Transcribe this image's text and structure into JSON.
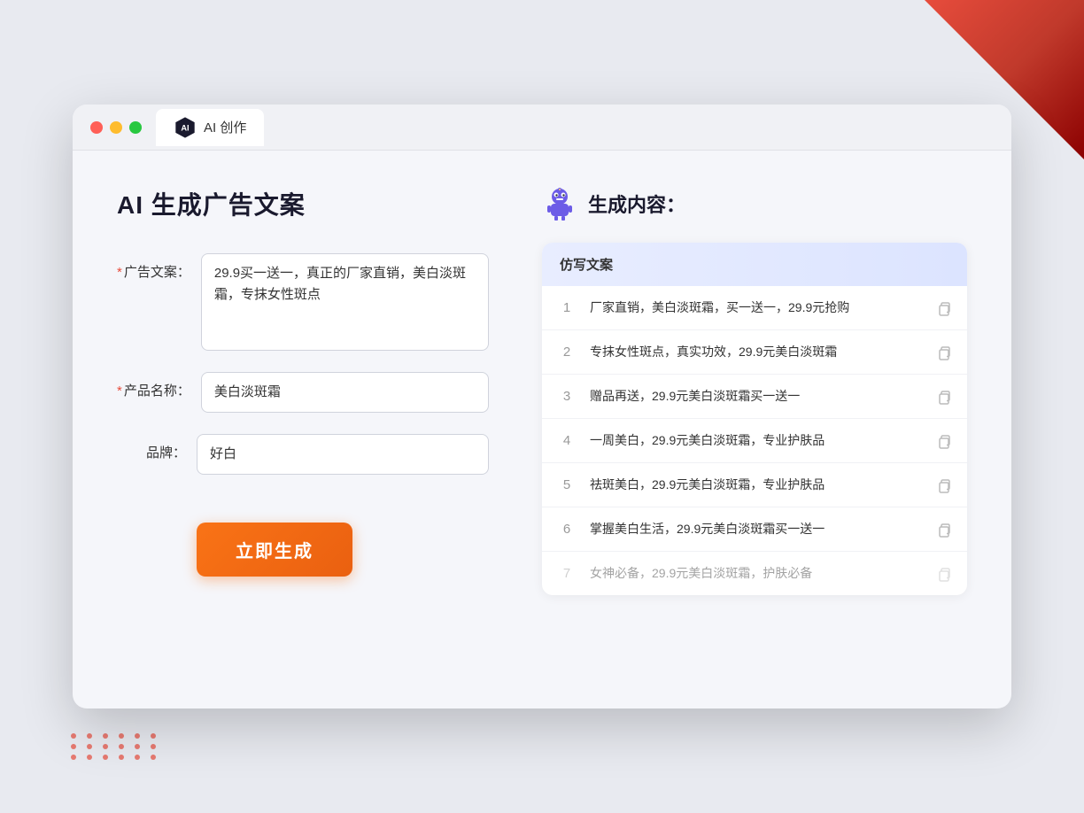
{
  "window": {
    "tab_label": "AI 创作",
    "traffic_lights": [
      "red",
      "yellow",
      "green"
    ]
  },
  "left_panel": {
    "title": "AI 生成广告文案",
    "form": {
      "ad_copy_label": "广告文案：",
      "ad_copy_required": "*",
      "ad_copy_value": "29.9买一送一，真正的厂家直销，美白淡斑霜，专抹女性斑点",
      "product_name_label": "产品名称：",
      "product_name_required": "*",
      "product_name_value": "美白淡斑霜",
      "brand_label": "品牌：",
      "brand_value": "好白"
    },
    "generate_button": "立即生成"
  },
  "right_panel": {
    "title": "生成内容：",
    "table_header": "仿写文案",
    "results": [
      {
        "num": "1",
        "text": "厂家直销，美白淡斑霜，买一送一，29.9元抢购",
        "faded": false
      },
      {
        "num": "2",
        "text": "专抹女性斑点，真实功效，29.9元美白淡斑霜",
        "faded": false
      },
      {
        "num": "3",
        "text": "赠品再送，29.9元美白淡斑霜买一送一",
        "faded": false
      },
      {
        "num": "4",
        "text": "一周美白，29.9元美白淡斑霜，专业护肤品",
        "faded": false
      },
      {
        "num": "5",
        "text": "祛斑美白，29.9元美白淡斑霜，专业护肤品",
        "faded": false
      },
      {
        "num": "6",
        "text": "掌握美白生活，29.9元美白淡斑霜买一送一",
        "faded": false
      },
      {
        "num": "7",
        "text": "女神必备，29.9元美白淡斑霜，护肤必备",
        "faded": true
      }
    ]
  }
}
